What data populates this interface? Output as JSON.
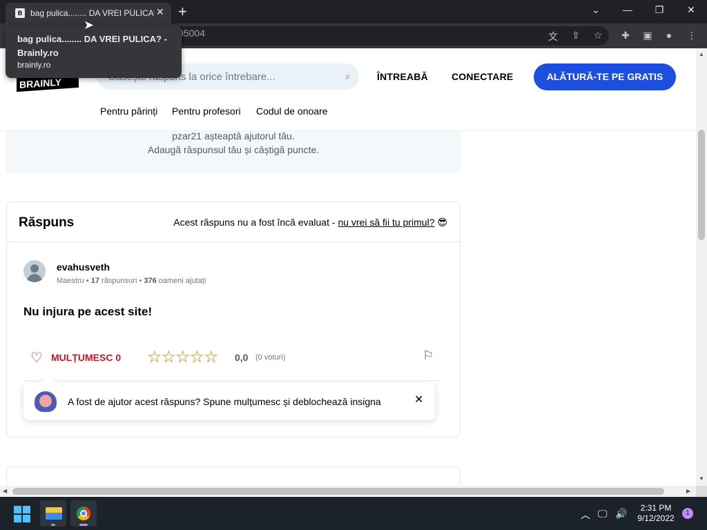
{
  "browser": {
    "tab_title": "bag pulica........ DA VREI PULICA?",
    "tab_favicon": "B",
    "url_fragment": "05004",
    "tooltip_title": "bag pulica........ DA VREI PULICA? - Brainly.ro",
    "tooltip_domain": "brainly.ro"
  },
  "header": {
    "logo_text": "BRAINLY",
    "search_placeholder": "Găsește răspuns la orice întrebare...",
    "ask_label": "ÎNTREABĂ",
    "login_label": "CONECTARE",
    "join_label": "ALĂTURĂ-TE PE GRATIS",
    "links": [
      "Pentru părinți",
      "Pentru profesori",
      "Codul de onoare"
    ]
  },
  "info": {
    "line1": "pzar21 așteaptă ajutorul tău.",
    "line2": "Adaugă răspunsul tău și câștigă puncte."
  },
  "answer": {
    "section_title": "Răspuns",
    "note_prefix": "Acest răspuns nu a fost încă evaluat - ",
    "note_link": "nu vrei să fii tu primul?",
    "note_emoji": "😎",
    "username": "evahusveth",
    "rank": "Maestru",
    "answers_count": "17",
    "answers_label": "răspunsuri",
    "helped_count": "376",
    "helped_label": "oameni ajutați",
    "text": "Nu injura pe acest site!",
    "thanks_label": "MULȚUMESC 0",
    "rating": "0,0",
    "votes": "(0 voturi)",
    "toast_message": "A fost de ajutor acest răspuns? Spune mulțumesc și deblochează insigna"
  },
  "taskbar": {
    "time": "2:31 PM",
    "date": "9/12/2022",
    "notifications": "1"
  },
  "colors": {
    "brand_blue": "#1d4ee0",
    "thanks_red": "#c5182c",
    "chrome_dark": "#202124"
  }
}
